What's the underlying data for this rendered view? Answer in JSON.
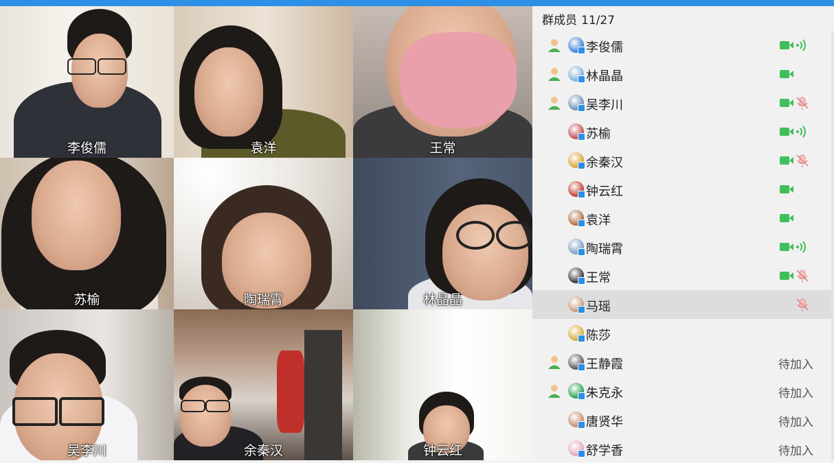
{
  "window": {
    "accent_color": "#2d8fe5"
  },
  "video_tiles": [
    {
      "name": "李俊儒"
    },
    {
      "name": "袁洋"
    },
    {
      "name": "王常"
    },
    {
      "name": "苏榆"
    },
    {
      "name": "陶瑞霄"
    },
    {
      "name": "林晶晶"
    },
    {
      "name": "吴李川"
    },
    {
      "name": "余秦汉"
    },
    {
      "name": "钟云红"
    }
  ],
  "members_panel": {
    "title": "群成员",
    "count": "11/27",
    "members": [
      {
        "name": "李俊儒",
        "host": true,
        "camera": true,
        "mic": "speaking",
        "status": ""
      },
      {
        "name": "林晶晶",
        "host": true,
        "camera": true,
        "mic": "none",
        "status": ""
      },
      {
        "name": "吴李川",
        "host": true,
        "camera": true,
        "mic": "muted",
        "status": ""
      },
      {
        "name": "苏榆",
        "host": false,
        "camera": true,
        "mic": "speaking",
        "status": ""
      },
      {
        "name": "余秦汉",
        "host": false,
        "camera": true,
        "mic": "muted",
        "status": ""
      },
      {
        "name": "钟云红",
        "host": false,
        "camera": true,
        "mic": "none",
        "status": ""
      },
      {
        "name": "袁洋",
        "host": false,
        "camera": true,
        "mic": "none",
        "status": ""
      },
      {
        "name": "陶瑞霄",
        "host": false,
        "camera": true,
        "mic": "speaking",
        "status": ""
      },
      {
        "name": "王常",
        "host": false,
        "camera": true,
        "mic": "muted",
        "status": ""
      },
      {
        "name": "马瑶",
        "host": false,
        "camera": false,
        "mic": "muted",
        "status": "",
        "selected": true
      },
      {
        "name": "陈莎",
        "host": false,
        "camera": false,
        "mic": "none",
        "status": ""
      },
      {
        "name": "王静霞",
        "host": true,
        "camera": false,
        "mic": "none",
        "status": "待加入"
      },
      {
        "name": "朱克永",
        "host": true,
        "camera": false,
        "mic": "none",
        "status": "待加入"
      },
      {
        "name": "唐贤华",
        "host": false,
        "camera": false,
        "mic": "none",
        "status": "待加入"
      },
      {
        "name": "舒学香",
        "host": false,
        "camera": false,
        "mic": "none",
        "status": "待加入"
      }
    ]
  }
}
